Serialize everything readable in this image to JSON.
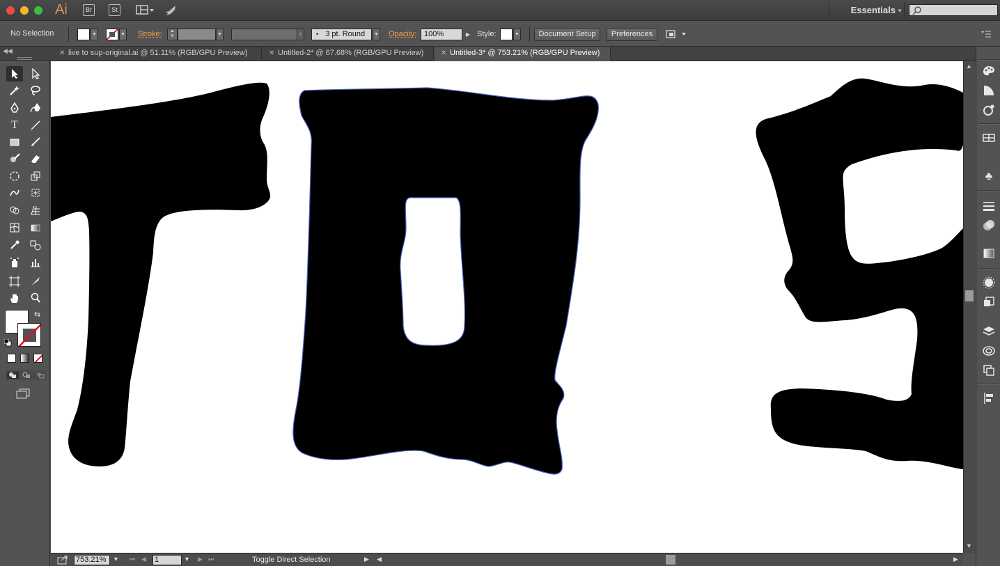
{
  "app": {
    "logo": "Ai",
    "bridge_label": "Br",
    "stock_label": "St",
    "workspace": "Essentials",
    "search_placeholder": ""
  },
  "control_bar": {
    "selection_status": "No Selection",
    "stroke_label": "Stroke:",
    "brush_label": "3 pt. Round",
    "opacity_label": "Opacity:",
    "opacity_value": "100%",
    "style_label": "Style:",
    "document_setup_label": "Document Setup",
    "preferences_label": "Preferences"
  },
  "tabs": [
    {
      "label": "live to sup-original.ai @ 51.11% (RGB/GPU Preview)",
      "active": false
    },
    {
      "label": "Untitled-2* @ 67.68% (RGB/GPU Preview)",
      "active": false
    },
    {
      "label": "Untitled-3* @ 753.21% (RGB/GPU Preview)",
      "active": true
    }
  ],
  "status_bar": {
    "zoom": "753.21%",
    "artboard": "1",
    "tool_status": "Toggle Direct Selection"
  },
  "colors": {
    "ui_bg": "#535353",
    "accent_orange": "#f0a24b",
    "selection_outline": "#4d63c9",
    "artwork": "#000000"
  }
}
